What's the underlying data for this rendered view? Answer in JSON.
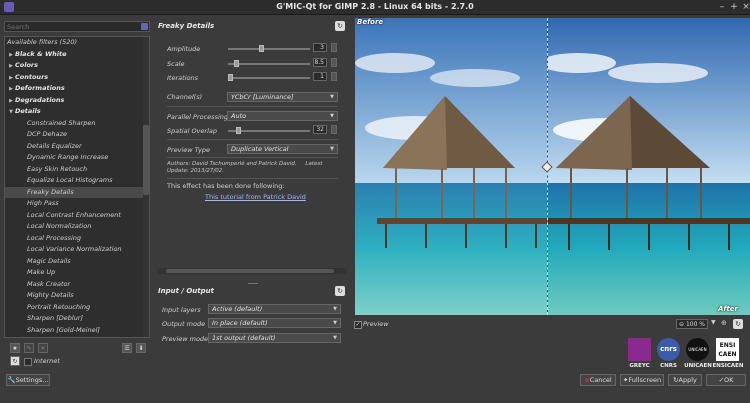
{
  "window": {
    "title": "G'MIC-Qt for GIMP 2.8 - Linux 64 bits - 2.7.0",
    "min": "–",
    "max": "+",
    "close": "×"
  },
  "search": {
    "placeholder": "Search"
  },
  "filters": {
    "header": "Available filters (520)",
    "rows": [
      {
        "label": "Black & White",
        "type": "cat",
        "expanded": false
      },
      {
        "label": "Colors",
        "type": "cat",
        "expanded": false
      },
      {
        "label": "Contours",
        "type": "cat",
        "expanded": false
      },
      {
        "label": "Deformations",
        "type": "cat",
        "expanded": false
      },
      {
        "label": "Degradations",
        "type": "cat",
        "expanded": false
      },
      {
        "label": "Details",
        "type": "cat",
        "expanded": true
      },
      {
        "label": "Constrained Sharpen",
        "type": "leaf"
      },
      {
        "label": "DCP Dehaze",
        "type": "leaf"
      },
      {
        "label": "Details Equalizer",
        "type": "leaf"
      },
      {
        "label": "Dynamic Range Increase",
        "type": "leaf"
      },
      {
        "label": "Easy Skin Retouch",
        "type": "leaf"
      },
      {
        "label": "Equalize Local Histograms",
        "type": "leaf"
      },
      {
        "label": "Freaky Details",
        "type": "leaf",
        "selected": true
      },
      {
        "label": "High Pass",
        "type": "leaf"
      },
      {
        "label": "Local Contrast Enhancement",
        "type": "leaf"
      },
      {
        "label": "Local Normalization",
        "type": "leaf"
      },
      {
        "label": "Local Processing",
        "type": "leaf"
      },
      {
        "label": "Local Variance Normalization",
        "type": "leaf"
      },
      {
        "label": "Magic Details",
        "type": "leaf"
      },
      {
        "label": "Make Up",
        "type": "leaf"
      },
      {
        "label": "Mask Creator",
        "type": "leaf"
      },
      {
        "label": "Mighty Details",
        "type": "leaf"
      },
      {
        "label": "Portrait Retouching",
        "type": "leaf"
      },
      {
        "label": "Sharpen [Deblur]",
        "type": "leaf"
      },
      {
        "label": "Sharpen [Gold-Meinel]",
        "type": "leaf"
      }
    ]
  },
  "internet_label": "Internet",
  "settings_label": "Settings...",
  "filter": {
    "title": "Freaky Details",
    "params": [
      {
        "label": "Amplitude",
        "value": "3",
        "level": 0.4
      },
      {
        "label": "Scale",
        "value": "8.5",
        "level": 0.08
      },
      {
        "label": "Iterations",
        "value": "1",
        "level": 0.0
      }
    ],
    "channels_label": "Channel(s)",
    "channels_value": "YCbCr [Luminance]",
    "parallel_label": "Parallel Processing",
    "parallel_value": "Auto",
    "overlap_label": "Spatial Overlap",
    "overlap_value": "32",
    "overlap_level": 0.1,
    "preview_type_label": "Preview Type",
    "preview_type_value": "Duplicate Vertical",
    "authors": "Authors: David Tschumperlé and Patrick David.     Latest Update: 2013/27/02.",
    "note": "This effect has been done following:",
    "link": "This tutorial from Patrick David"
  },
  "io": {
    "title": "Input / Output",
    "input_layers_label": "Input layers",
    "input_layers_value": "Active (default)",
    "output_mode_label": "Output mode",
    "output_mode_value": "In place (default)",
    "preview_mode_label": "Preview mode",
    "preview_mode_value": "1st output (default)"
  },
  "preview": {
    "before_label": "Before",
    "after_label": "After",
    "checkbox_label": "Preview",
    "zoom": "100 %"
  },
  "logos": [
    "GREYC",
    "CNRS",
    "UNICAEN",
    "ENSICAEN"
  ],
  "logo_marks": {
    "cnrs": "cnrs",
    "unicaen": "UNICAEN",
    "ensicaen_top": "ENSI",
    "ensicaen_bottom": "CAEN"
  },
  "buttons": {
    "cancel": "Cancel",
    "fullscreen": "Fullscreen",
    "apply": "Apply",
    "ok": "OK"
  },
  "colors": {
    "sky_top": "#3f7fc4",
    "sea": "#2fb0c0",
    "accent_red": "#c0302a"
  }
}
